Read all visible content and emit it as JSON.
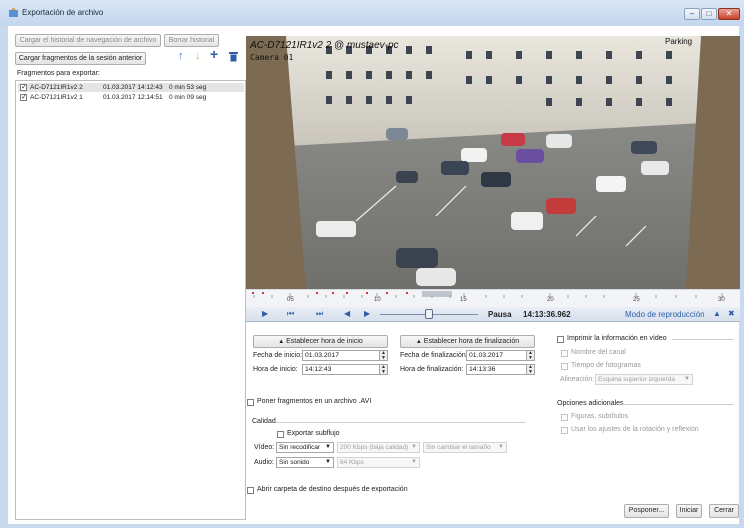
{
  "window": {
    "title": "Exportación de archivo",
    "buttons": {
      "minimize": "–",
      "maximize": "□",
      "close": "✕"
    }
  },
  "toolbar": {
    "load_history": "Cargar el historial de navegación de archivo",
    "clear_history": "Borrar historial",
    "load_previous": "Cargar fragmentos de la sesión anterior"
  },
  "fragments": {
    "label": "Fragmentos para exportar:",
    "items": [
      {
        "checked": "✓",
        "name": "AC-D7121IR1v2 2",
        "datetime": "01.03.2017 14:12:43",
        "duration": "0 min 53 seg"
      },
      {
        "checked": "✓",
        "name": "AC-D7121IR1v2 1",
        "datetime": "01.03.2017 12:14:51",
        "duration": "0 min 09 seg"
      }
    ]
  },
  "video": {
    "overlay_title": "AC-D7121IR1v2 2 @ mustaev-pc",
    "overlay_camera": "Camera 01",
    "overlay_parking": "Parking"
  },
  "timeline": {
    "ticks": [
      "05",
      "10",
      "15",
      "20",
      "25",
      "30"
    ]
  },
  "player": {
    "state": "Pausa",
    "time": "14:13:36.962",
    "mode": "Modo de reproducción"
  },
  "start": {
    "button": "Establecer hora de inicio",
    "date_label": "Fecha de inicio:",
    "date": "01.03.2017",
    "time_label": "Hora de inicio:",
    "time": "14:12:43"
  },
  "end": {
    "button": "Establecer hora de finalización",
    "date_label": "Fecha de finalización:",
    "date": "01.03.2017",
    "time_label": "Hora de finalización:",
    "time": "14:13:36"
  },
  "print_info": {
    "title": "Imprimir la información en vídeo",
    "channel_name": "Nombre del canal",
    "frame_time": "Tiempo de fotogramas",
    "alignment_label": "Alineación:",
    "alignment_value": "Esquina superior izquierda"
  },
  "additional": {
    "title": "Opciones adicionales",
    "shapes": "Figuras, subtítulos",
    "rotation": "Usar los ajustes de la rotación y reflexión"
  },
  "avi": {
    "label": "Poner fragmentos en un archivo .AVI"
  },
  "quality": {
    "title": "Calidad",
    "export_substream": "Exportar subflujo",
    "video_label": "Vídeo:",
    "video_codec": "Sin recodificar",
    "video_bitrate": "200 Kbps (baja calidad)",
    "video_size": "Sin cambiar el tamaño",
    "audio_label": "Audio:",
    "audio_codec": "Sin sonido",
    "audio_bitrate": "64 Kbps"
  },
  "open_folder": {
    "label": "Abrir carpeta de destino después de exportación"
  },
  "footer": {
    "postpone": "Posponer...",
    "start": "Iniciar",
    "close": "Cerrar"
  },
  "colors": {
    "accent": "#2e5fa7",
    "titlebar": "#c9d9ee",
    "arrow_up": "#3a7bd5",
    "arrow_down": "#e8a02a"
  }
}
